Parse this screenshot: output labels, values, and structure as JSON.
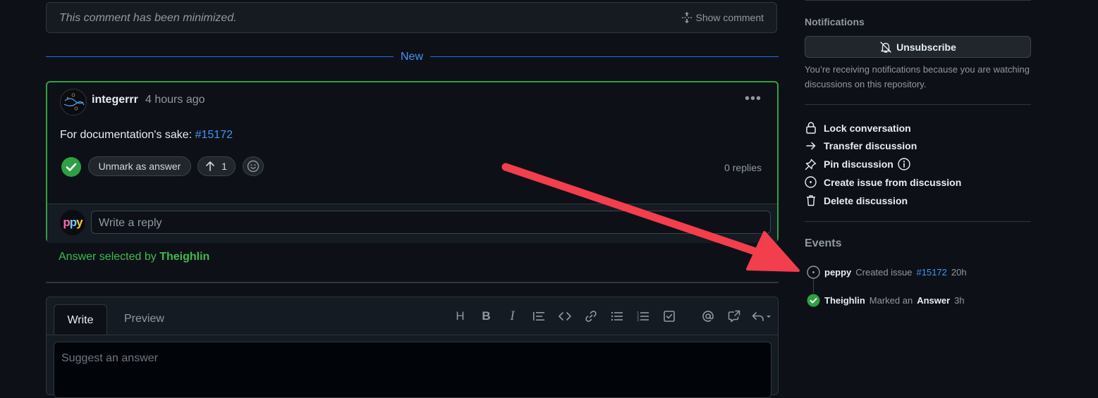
{
  "minimized": {
    "text": "This comment has been minimized.",
    "show_label": "Show comment"
  },
  "divider": {
    "label": "New"
  },
  "answer": {
    "author": "integerrr",
    "time": "4 hours ago",
    "body_prefix": "For documentation's sake: ",
    "body_link": "#15172",
    "unmark_label": "Unmark as answer",
    "upvotes": "1",
    "replies": "0 replies",
    "reply_placeholder": "Write a reply",
    "reply_avatar_text": "ppy"
  },
  "answer_selected": {
    "prefix": "Answer selected by ",
    "user": "Theighlin"
  },
  "editor": {
    "tab_write": "Write",
    "tab_preview": "Preview",
    "placeholder": "Suggest an answer",
    "toolbar_heading": "H",
    "toolbar_bold": "B",
    "toolbar_italic": "I"
  },
  "sidebar": {
    "notifications_heading": "Notifications",
    "unsubscribe_label": "Unsubscribe",
    "notifications_text": "You’re receiving notifications because you are watching discussions on this repository.",
    "actions": [
      {
        "label": "Lock conversation",
        "icon": "lock-icon"
      },
      {
        "label": "Transfer discussion",
        "icon": "arrow-right-icon"
      },
      {
        "label": "Pin discussion",
        "icon": "pin-icon"
      },
      {
        "label": "Create issue from discussion",
        "icon": "issue-opened-icon"
      },
      {
        "label": "Delete discussion",
        "icon": "trash-icon"
      }
    ],
    "events_heading": "Events",
    "events": [
      {
        "user": "peppy",
        "text": "Created issue",
        "link": "#15172",
        "time": "20h"
      },
      {
        "user": "Theighlin",
        "text": "Marked an",
        "target": "Answer",
        "time": "3h"
      }
    ]
  },
  "colors": {
    "background": "#0d1117",
    "accent_blue": "#4493f8",
    "success_green": "#2ea043",
    "annotation_red": "#f23e4d"
  }
}
